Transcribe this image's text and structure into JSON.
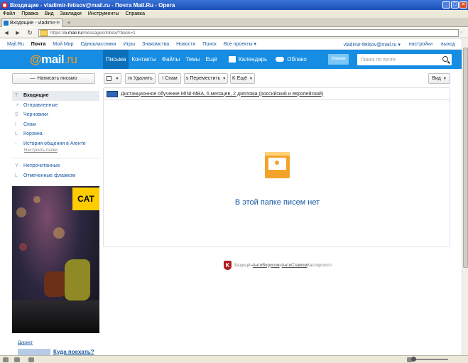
{
  "window": {
    "title": "Входящие - vladimir-fetisov@mail.ru - Почта Mail.Ru - Opera",
    "menu": [
      "Файл",
      "Правка",
      "Вид",
      "Закладки",
      "Инструменты",
      "Справка"
    ]
  },
  "tab": {
    "label": "Входящие - vladimir-fetis..."
  },
  "address": {
    "https": "https://",
    "host": "e.mail.ru",
    "path": "/messages/inbox/?back=1"
  },
  "portal": {
    "links": [
      "Mail.Ru",
      "Почта",
      "Мой Мир",
      "Одноклассники",
      "Игры",
      "Знакомства",
      "Новости",
      "Поиск",
      "Все проекты ▾"
    ],
    "active_index": 1,
    "user": "vladimir-fetisov@mail.ru ▾",
    "settings": "настройки",
    "logout": "выход"
  },
  "header": {
    "logo_at": "@",
    "logo_mail": "mail",
    "logo_ru": ".ru",
    "nav": [
      "Письма",
      "Контакты",
      "Файлы",
      "Темы",
      "Ещё"
    ],
    "calendar": "Календарь",
    "cloud": "Облако",
    "mamam": "Мамам",
    "search_placeholder": "Поиск по почте"
  },
  "compose": {
    "label": "Написать письмо"
  },
  "toolbar": {
    "delete": "Удалить",
    "spam": "Спам",
    "move": "Переместить",
    "more": "Ещё",
    "view": "Вид"
  },
  "folders": [
    {
      "icon": "T",
      "label": "Входящие",
      "active": true
    },
    {
      "icon": "↗",
      "label": "Отправленные",
      "active": false
    },
    {
      "icon": "S",
      "label": "Черновики",
      "active": false
    },
    {
      "icon": "!",
      "label": "Спам",
      "active": false
    },
    {
      "icon": "L",
      "label": "Корзина",
      "active": false
    },
    {
      "icon": "◦",
      "label": "История общения в Агенте",
      "active": false
    }
  ],
  "setup_folders": "Настроить папки",
  "filters": [
    {
      "icon": "Y",
      "label": "Непрочитанные"
    },
    {
      "icon": "L",
      "label": "Отмеченные флажком"
    }
  ],
  "promo": {
    "text": "Дистанционное обучение MINI-MBA, 6 месяцев, 2 диплома (российский и европейский)"
  },
  "empty": {
    "text": "В этой папке писем нет"
  },
  "kaspersky": {
    "prefix": "Защищён ",
    "antivirus": "АнтиВирусом",
    "and": " и ",
    "antispam": "АнтиСпамом",
    "suffix": " Касперского"
  },
  "ad": {
    "brand": "CAT",
    "direct": "Директ",
    "link": "Куда поехать?"
  },
  "colors": {
    "accent": "#168de2",
    "accent_dark": "#0b6fba",
    "logo_orange": "#f59e1f",
    "link": "#1a5aa3"
  }
}
